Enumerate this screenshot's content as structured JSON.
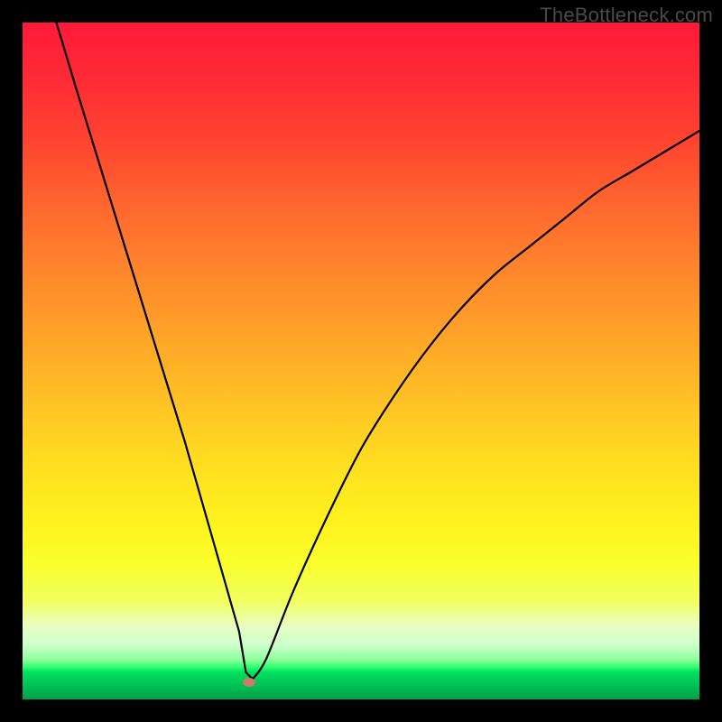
{
  "watermark": "TheBottleneck.com",
  "chart_data": {
    "type": "line",
    "title": "",
    "xlabel": "",
    "ylabel": "",
    "xlim": [
      0,
      100
    ],
    "ylim": [
      0,
      100
    ],
    "grid": false,
    "legend": false,
    "series": [
      {
        "name": "bottleneck-curve",
        "x": [
          5,
          8,
          12,
          16,
          20,
          24,
          28,
          30,
          32,
          33,
          34,
          36,
          40,
          45,
          50,
          55,
          60,
          65,
          70,
          75,
          80,
          85,
          90,
          95,
          100
        ],
        "values": [
          100,
          90,
          77,
          64,
          51,
          38,
          24,
          17,
          10,
          4,
          3,
          6,
          16,
          27,
          37,
          45,
          52,
          58,
          63,
          67,
          71,
          75,
          78,
          81,
          84
        ]
      }
    ],
    "minimum_marker": {
      "x": 33.5,
      "y": 2.5
    },
    "background_gradient": {
      "top": "#ff1a3a",
      "mid": "#ffe020",
      "bottom": "#00a048"
    },
    "frame_color": "#000000"
  }
}
